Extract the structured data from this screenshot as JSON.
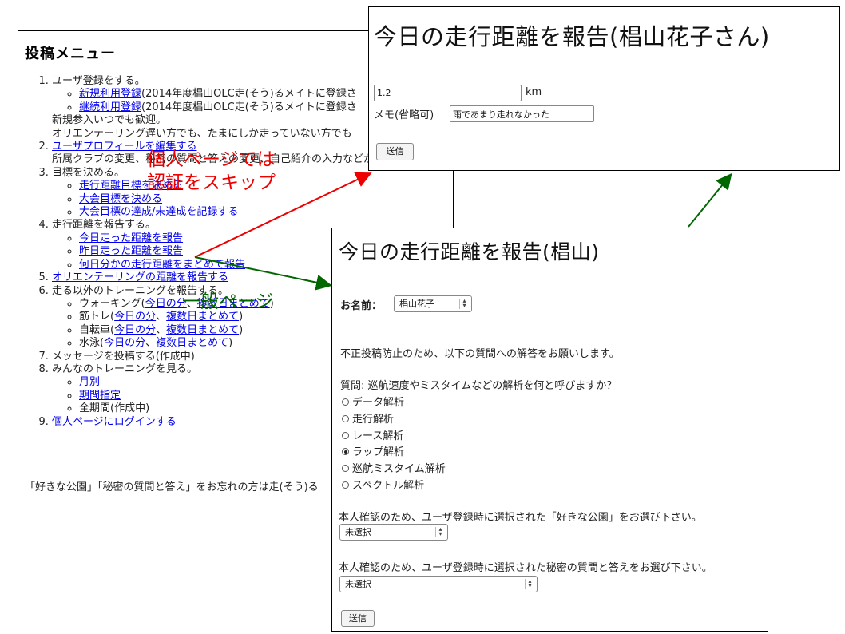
{
  "menu": {
    "title": "投稿メニュー",
    "items": [
      {
        "text": "ユーザ登録をする。",
        "links": [
          {
            "link": "新規利用登録",
            "after": "(2014年度椙山OLC走(そう)るメイトに登録さ"
          },
          {
            "link": "継続利用登録",
            "after": "(2014年度椙山OLC走(そう)るメイトに登録さ"
          }
        ],
        "notes": [
          "新規参入いつでも歓迎。",
          "オリエンテーリング遅い方でも、たまにしか走っていない方でも"
        ]
      },
      {
        "link": "ユーザプロフィールを編集する",
        "notes": [
          "所属クラブの変更、秘密の質問と答えの変更、自己紹介の入力などができます。"
        ]
      },
      {
        "text": "目標を決める。",
        "links": [
          {
            "link": "走行距離目標を決める"
          },
          {
            "link": "大会目標を決める"
          },
          {
            "link": "大会目標の達成/未達成を記録する"
          }
        ]
      },
      {
        "text": "走行距離を報告する。",
        "links": [
          {
            "link": "今日走った距離を報告"
          },
          {
            "link": "昨日走った距離を報告"
          },
          {
            "link": "何日分かの走行距離をまとめて報告"
          }
        ]
      },
      {
        "link": "オリエンテーリングの距離を報告する"
      },
      {
        "text": "走る以外のトレーニングを報告する。",
        "training": [
          {
            "name": "ウォーキング",
            "today": "今日の分",
            "multi": "複数日まとめて"
          },
          {
            "name": "筋トレ",
            "today": "今日の分",
            "multi": "複数日まとめて"
          },
          {
            "name": "自転車",
            "today": "今日の分",
            "multi": "複数日まとめて"
          },
          {
            "name": "水泳",
            "today": "今日の分",
            "multi": "複数日まとめて"
          }
        ]
      },
      {
        "text": "メッセージを投稿する(作成中)"
      },
      {
        "text": "みんなのトレーニングを見る。",
        "links": [
          {
            "link": "月別"
          },
          {
            "link": "期間指定"
          },
          {
            "plain": "全期間(作成中)"
          }
        ]
      },
      {
        "link": "個人ページにログインする"
      }
    ],
    "footer": "「好きな公園」「秘密の質問と答え」をお忘れの方は走(そう)る"
  },
  "auth_window": {
    "title": "今日の走行距離を報告(椙山花子さん)",
    "distance_value": "1.2",
    "unit": "km",
    "memo_label": "メモ(省略可)",
    "memo_value": "雨であまり走れなかった",
    "submit": "送信"
  },
  "general_window": {
    "title": "今日の走行距離を報告(椙山)",
    "name_label": "お名前：",
    "name_value": "椙山花子",
    "spam_notice": "不正投稿防止のため、以下の質問への解答をお願いします。",
    "question": "質問: 巡航速度やミスタイムなどの解析を何と呼びますか？",
    "options": [
      "データ解析",
      "走行解析",
      "レース解析",
      "ラップ解析",
      "巡航ミスタイム解析",
      "スペクトル解析"
    ],
    "selected_option": 3,
    "park_prompt": "本人確認のため、ユーザ登録時に選択された「好きな公園」をお選び下さい。",
    "park_value": "未選択",
    "secret_prompt": "本人確認のため、ユーザ登録時に選択された秘密の質問と答えをお選び下さい。",
    "secret_value": "未選択",
    "submit": "送信"
  },
  "annotations": {
    "red_line1": "個人ページでは",
    "red_line2": "認証をスキップ",
    "green": "一般ページ",
    "red_color": "#ee0000",
    "green_color": "#006600"
  }
}
